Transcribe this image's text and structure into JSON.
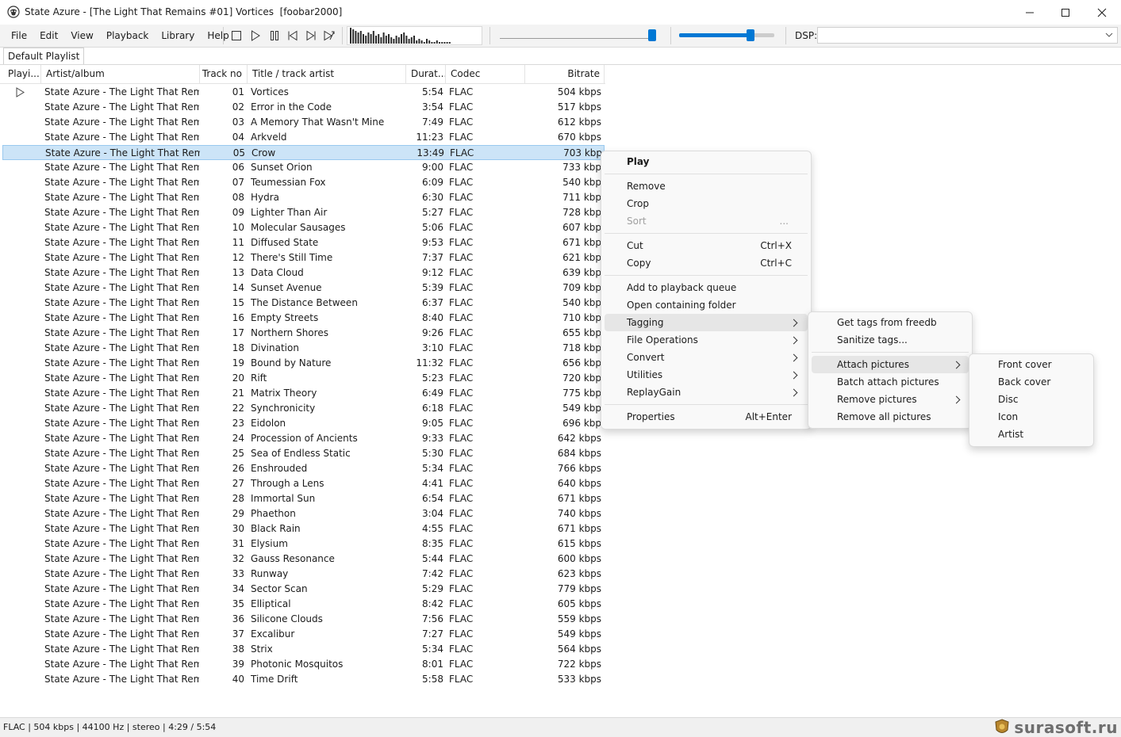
{
  "window": {
    "title": "State Azure - [The Light That Remains #01] Vortices  [foobar2000]"
  },
  "menu": [
    "File",
    "Edit",
    "View",
    "Playback",
    "Library",
    "Help"
  ],
  "toolbar": {
    "dsp_label": "DSP:",
    "dsp_value": "",
    "seek_position": 0.98,
    "volume_level": 0.75
  },
  "visualizer_bars": [
    20,
    18,
    16,
    14,
    16,
    12,
    10,
    14,
    12,
    16,
    10,
    12,
    8,
    14,
    10,
    12,
    8,
    6,
    10,
    8,
    12,
    14,
    10,
    6,
    8,
    10,
    4,
    6,
    4,
    2,
    6,
    4,
    2,
    2,
    4,
    2,
    2,
    2,
    2,
    2
  ],
  "tabs": [
    "Default Playlist"
  ],
  "columns": {
    "playing": "Playi...",
    "artist": "Artist/album",
    "track": "Track no",
    "title": "Title / track artist",
    "duration": "Durat...",
    "codec": "Codec",
    "bitrate": "Bitrate"
  },
  "playlist": [
    {
      "artist": "State Azure - The Light That Remai...",
      "track": "01",
      "title": "Vortices",
      "duration": "5:54",
      "codec": "FLAC",
      "bitrate": "504 kbps"
    },
    {
      "artist": "State Azure - The Light That Remai...",
      "track": "02",
      "title": "Error in the Code",
      "duration": "3:54",
      "codec": "FLAC",
      "bitrate": "517 kbps"
    },
    {
      "artist": "State Azure - The Light That Remai...",
      "track": "03",
      "title": "A Memory That Wasn't Mine",
      "duration": "7:49",
      "codec": "FLAC",
      "bitrate": "612 kbps"
    },
    {
      "artist": "State Azure - The Light That Remai...",
      "track": "04",
      "title": "Arkveld",
      "duration": "11:23",
      "codec": "FLAC",
      "bitrate": "670 kbps"
    },
    {
      "artist": "State Azure - The Light That Remai...",
      "track": "05",
      "title": "Crow",
      "duration": "13:49",
      "codec": "FLAC",
      "bitrate": "703 kbp"
    },
    {
      "artist": "State Azure - The Light That Remai...",
      "track": "06",
      "title": "Sunset Orion",
      "duration": "9:00",
      "codec": "FLAC",
      "bitrate": "733 kbp"
    },
    {
      "artist": "State Azure - The Light That Remai...",
      "track": "07",
      "title": "Teumessian Fox",
      "duration": "6:09",
      "codec": "FLAC",
      "bitrate": "540 kbp"
    },
    {
      "artist": "State Azure - The Light That Remai...",
      "track": "08",
      "title": "Hydra",
      "duration": "6:30",
      "codec": "FLAC",
      "bitrate": "711 kbp"
    },
    {
      "artist": "State Azure - The Light That Remai...",
      "track": "09",
      "title": "Lighter Than Air",
      "duration": "5:27",
      "codec": "FLAC",
      "bitrate": "728 kbp"
    },
    {
      "artist": "State Azure - The Light That Remai...",
      "track": "10",
      "title": "Molecular Sausages",
      "duration": "5:06",
      "codec": "FLAC",
      "bitrate": "607 kbp"
    },
    {
      "artist": "State Azure - The Light That Remai...",
      "track": "11",
      "title": "Diffused State",
      "duration": "9:53",
      "codec": "FLAC",
      "bitrate": "671 kbp"
    },
    {
      "artist": "State Azure - The Light That Remai...",
      "track": "12",
      "title": "There's Still Time",
      "duration": "7:37",
      "codec": "FLAC",
      "bitrate": "621 kbp"
    },
    {
      "artist": "State Azure - The Light That Remai...",
      "track": "13",
      "title": "Data Cloud",
      "duration": "9:12",
      "codec": "FLAC",
      "bitrate": "639 kbp"
    },
    {
      "artist": "State Azure - The Light That Remai...",
      "track": "14",
      "title": "Sunset Avenue",
      "duration": "5:39",
      "codec": "FLAC",
      "bitrate": "709 kbp"
    },
    {
      "artist": "State Azure - The Light That Remai...",
      "track": "15",
      "title": "The Distance Between",
      "duration": "6:37",
      "codec": "FLAC",
      "bitrate": "540 kbp"
    },
    {
      "artist": "State Azure - The Light That Remai...",
      "track": "16",
      "title": "Empty Streets",
      "duration": "8:40",
      "codec": "FLAC",
      "bitrate": "710 kbp"
    },
    {
      "artist": "State Azure - The Light That Remai...",
      "track": "17",
      "title": "Northern Shores",
      "duration": "9:26",
      "codec": "FLAC",
      "bitrate": "655 kbp"
    },
    {
      "artist": "State Azure - The Light That Remai...",
      "track": "18",
      "title": "Divination",
      "duration": "3:10",
      "codec": "FLAC",
      "bitrate": "718 kbp"
    },
    {
      "artist": "State Azure - The Light That Remai...",
      "track": "19",
      "title": "Bound by Nature",
      "duration": "11:32",
      "codec": "FLAC",
      "bitrate": "656 kbp"
    },
    {
      "artist": "State Azure - The Light That Remai...",
      "track": "20",
      "title": "Rift",
      "duration": "5:23",
      "codec": "FLAC",
      "bitrate": "720 kbp"
    },
    {
      "artist": "State Azure - The Light That Remai...",
      "track": "21",
      "title": "Matrix Theory",
      "duration": "6:49",
      "codec": "FLAC",
      "bitrate": "775 kbp"
    },
    {
      "artist": "State Azure - The Light That Remai...",
      "track": "22",
      "title": "Synchronicity",
      "duration": "6:18",
      "codec": "FLAC",
      "bitrate": "549 kbp"
    },
    {
      "artist": "State Azure - The Light That Remai...",
      "track": "23",
      "title": "Eidolon",
      "duration": "9:05",
      "codec": "FLAC",
      "bitrate": "696 kbp"
    },
    {
      "artist": "State Azure - The Light That Remai...",
      "track": "24",
      "title": "Procession of Ancients",
      "duration": "9:33",
      "codec": "FLAC",
      "bitrate": "642 kbps"
    },
    {
      "artist": "State Azure - The Light That Remai...",
      "track": "25",
      "title": "Sea of Endless Static",
      "duration": "5:30",
      "codec": "FLAC",
      "bitrate": "684 kbps"
    },
    {
      "artist": "State Azure - The Light That Remai...",
      "track": "26",
      "title": "Enshrouded",
      "duration": "5:34",
      "codec": "FLAC",
      "bitrate": "766 kbps"
    },
    {
      "artist": "State Azure - The Light That Remai...",
      "track": "27",
      "title": "Through a Lens",
      "duration": "4:41",
      "codec": "FLAC",
      "bitrate": "640 kbps"
    },
    {
      "artist": "State Azure - The Light That Remai...",
      "track": "28",
      "title": "Immortal Sun",
      "duration": "6:54",
      "codec": "FLAC",
      "bitrate": "671 kbps"
    },
    {
      "artist": "State Azure - The Light That Remai...",
      "track": "29",
      "title": "Phaethon",
      "duration": "3:04",
      "codec": "FLAC",
      "bitrate": "740 kbps"
    },
    {
      "artist": "State Azure - The Light That Remai...",
      "track": "30",
      "title": "Black Rain",
      "duration": "4:55",
      "codec": "FLAC",
      "bitrate": "671 kbps"
    },
    {
      "artist": "State Azure - The Light That Remai...",
      "track": "31",
      "title": "Elysium",
      "duration": "8:35",
      "codec": "FLAC",
      "bitrate": "615 kbps"
    },
    {
      "artist": "State Azure - The Light That Remai...",
      "track": "32",
      "title": "Gauss Resonance",
      "duration": "5:44",
      "codec": "FLAC",
      "bitrate": "600 kbps"
    },
    {
      "artist": "State Azure - The Light That Remai...",
      "track": "33",
      "title": "Runway",
      "duration": "7:42",
      "codec": "FLAC",
      "bitrate": "623 kbps"
    },
    {
      "artist": "State Azure - The Light That Remai...",
      "track": "34",
      "title": "Sector Scan",
      "duration": "5:29",
      "codec": "FLAC",
      "bitrate": "779 kbps"
    },
    {
      "artist": "State Azure - The Light That Remai...",
      "track": "35",
      "title": "Elliptical",
      "duration": "8:42",
      "codec": "FLAC",
      "bitrate": "605 kbps"
    },
    {
      "artist": "State Azure - The Light That Remai...",
      "track": "36",
      "title": "Silicone Clouds",
      "duration": "7:56",
      "codec": "FLAC",
      "bitrate": "559 kbps"
    },
    {
      "artist": "State Azure - The Light That Remai...",
      "track": "37",
      "title": "Excalibur",
      "duration": "7:27",
      "codec": "FLAC",
      "bitrate": "549 kbps"
    },
    {
      "artist": "State Azure - The Light That Remai...",
      "track": "38",
      "title": "Strix",
      "duration": "5:34",
      "codec": "FLAC",
      "bitrate": "564 kbps"
    },
    {
      "artist": "State Azure - The Light That Remai...",
      "track": "39",
      "title": "Photonic Mosquitos",
      "duration": "8:01",
      "codec": "FLAC",
      "bitrate": "722 kbps"
    },
    {
      "artist": "State Azure - The Light That Remai...",
      "track": "40",
      "title": "Time Drift",
      "duration": "5:58",
      "codec": "FLAC",
      "bitrate": "533 kbps"
    }
  ],
  "playing_index": 0,
  "selected_index": 4,
  "context_menu": {
    "play": "Play",
    "remove": "Remove",
    "crop": "Crop",
    "sort": "Sort",
    "sort_ellipsis": "...",
    "cut": "Cut",
    "cut_shortcut": "Ctrl+X",
    "copy": "Copy",
    "copy_shortcut": "Ctrl+C",
    "add_queue": "Add to playback queue",
    "open_folder": "Open containing folder",
    "tagging": "Tagging",
    "file_operations": "File Operations",
    "convert": "Convert",
    "utilities": "Utilities",
    "replaygain": "ReplayGain",
    "properties": "Properties",
    "properties_shortcut": "Alt+Enter"
  },
  "tagging_menu": {
    "freedb": "Get tags from freedb",
    "sanitize": "Sanitize tags...",
    "attach": "Attach pictures",
    "batch_attach": "Batch attach pictures",
    "remove_pictures": "Remove pictures",
    "remove_all": "Remove all pictures"
  },
  "attach_menu": [
    "Front cover",
    "Back cover",
    "Disc",
    "Icon",
    "Artist"
  ],
  "status": {
    "text": "FLAC | 504 kbps | 44100 Hz | stereo | 4:29 / 5:54"
  },
  "watermark": {
    "text": "surasoft.ru"
  },
  "colors": {
    "accent": "#0078d4",
    "selection": "#cce4f7",
    "menu_highlight": "#e6e6e6"
  }
}
